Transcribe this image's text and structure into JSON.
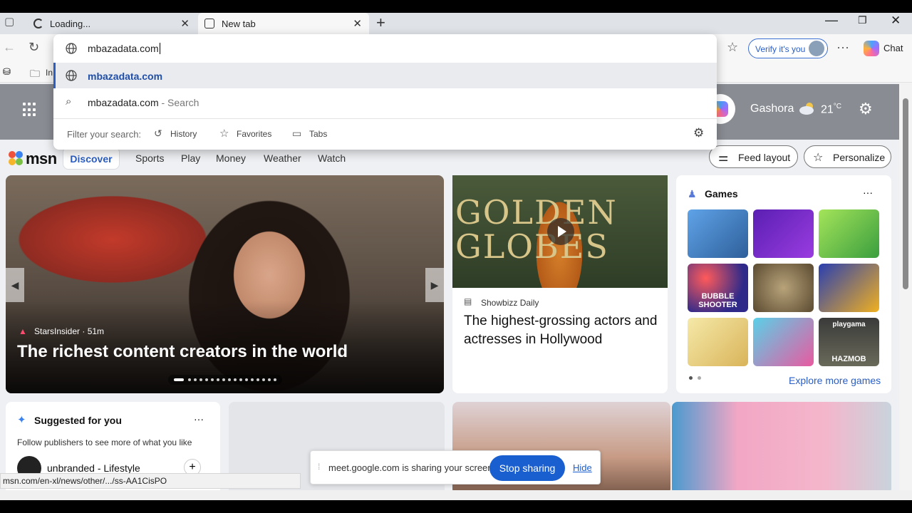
{
  "tabs": [
    {
      "label": "Loading..."
    },
    {
      "label": "New tab"
    }
  ],
  "toolbar": {
    "address_value": "mbazadata.com",
    "verify_label": "Verify it's you",
    "chat_label": "Chat",
    "fav_partial": "In"
  },
  "omnibox": {
    "suggestion_url": "mbazadata.com",
    "search_query": "mbazadata.com",
    "search_suffix": "- Search",
    "filter_label": "Filter your search:",
    "filters": [
      "History",
      "Favorites",
      "Tabs"
    ]
  },
  "hero": {
    "location": "Gashora",
    "temperature": "21",
    "unit": "°C"
  },
  "msn_nav": {
    "logo": "msn",
    "items": [
      "Discover",
      "Sports",
      "Play",
      "Money",
      "Weather",
      "Watch"
    ],
    "feed_layout": "Feed layout",
    "personalize": "Personalize"
  },
  "main_story": {
    "source": "StarsInsider",
    "age": "· 51m",
    "headline": "The richest content creators in the world"
  },
  "side_story": {
    "image_text_line1": "GOLDEN",
    "image_text_line2": "GLOBES",
    "source": "Showbizz Daily",
    "headline": "The highest-grossing actors and actresses in Hollywood"
  },
  "games": {
    "title": "Games",
    "more": "···",
    "explore": "Explore more games",
    "tile_labels": [
      "BUBBLE SHOOTER",
      "playgama",
      "HAZMOB"
    ]
  },
  "suggested": {
    "title": "Suggested for you",
    "subtitle": "Follow publishers to see more of what you like",
    "publisher": "unbranded - Lifestyle",
    "more": "···",
    "add": "+"
  },
  "status_url": "msn.com/en-xl/news/other/.../ss-AA1CisPO",
  "share_notice": {
    "text": "meet.google.com is sharing your screen.",
    "stop": "Stop sharing",
    "hide": "Hide"
  },
  "colors": {
    "accent": "#2a5ec4",
    "stop_button": "#1a5fd0",
    "hero_bg": "#898d93"
  }
}
